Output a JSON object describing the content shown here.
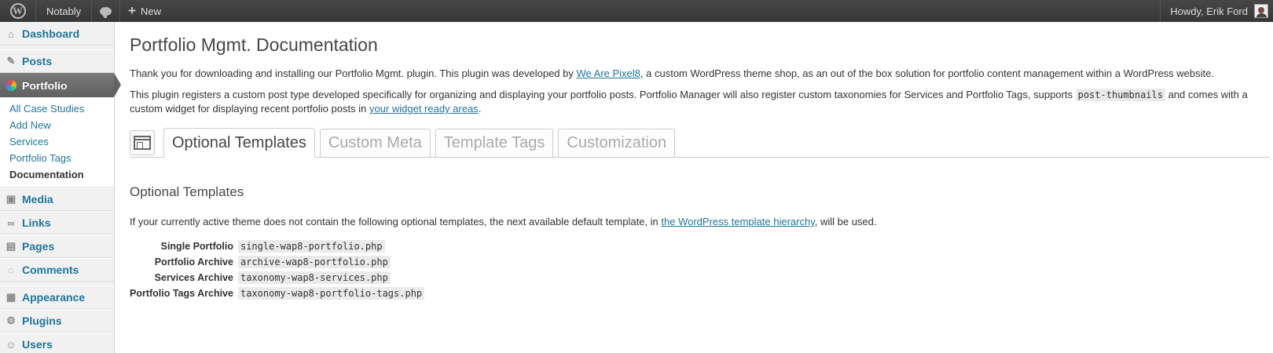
{
  "adminbar": {
    "logo_glyph": "W",
    "site_name": "Notably",
    "new_label": "New",
    "howdy": "Howdy, Erik Ford"
  },
  "sidebar": {
    "dashboard": "Dashboard",
    "posts": "Posts",
    "portfolio": "Portfolio",
    "submenu": [
      "All Case Studies",
      "Add New",
      "Services",
      "Portfolio Tags",
      "Documentation"
    ],
    "media": "Media",
    "links": "Links",
    "pages": "Pages",
    "comments": "Comments",
    "appearance": "Appearance",
    "plugins": "Plugins",
    "users": "Users"
  },
  "page": {
    "title": "Portfolio Mgmt. Documentation",
    "intro_1a": "Thank you for downloading and installing our Portfolio Mgmt. plugin. This plugin was developed by ",
    "intro_1_link": "We Are Pixel8",
    "intro_1b": ", a custom WordPress theme shop, as an out of the box solution for portfolio content management within a WordPress website.",
    "intro_2a": "This plugin registers a custom post type developed specifically for organizing and displaying your portfolio posts. Portfolio Manager will also register custom taxonomies for Services and Portfolio Tags, supports ",
    "intro_2_code": "post-thumbnails",
    "intro_2b": " and comes with a custom widget for displaying recent portfolio posts in ",
    "intro_2_link": "your widget ready areas",
    "intro_2c": "."
  },
  "tabs": [
    "Optional Templates",
    "Custom Meta",
    "Template Tags",
    "Customization"
  ],
  "section": {
    "heading": "Optional Templates",
    "desc_a": "If your currently active theme does not contain the following optional templates, the next available default template, in ",
    "desc_link": "the WordPress template hierarchy",
    "desc_b": ", will be used.",
    "rows": [
      {
        "label": "Single Portfolio",
        "file": "single-wap8-portfolio.php"
      },
      {
        "label": "Portfolio Archive",
        "file": "archive-wap8-portfolio.php"
      },
      {
        "label": "Services Archive",
        "file": "taxonomy-wap8-services.php"
      },
      {
        "label": "Portfolio Tags Archive",
        "file": "taxonomy-wap8-portfolio-tags.php"
      }
    ]
  }
}
